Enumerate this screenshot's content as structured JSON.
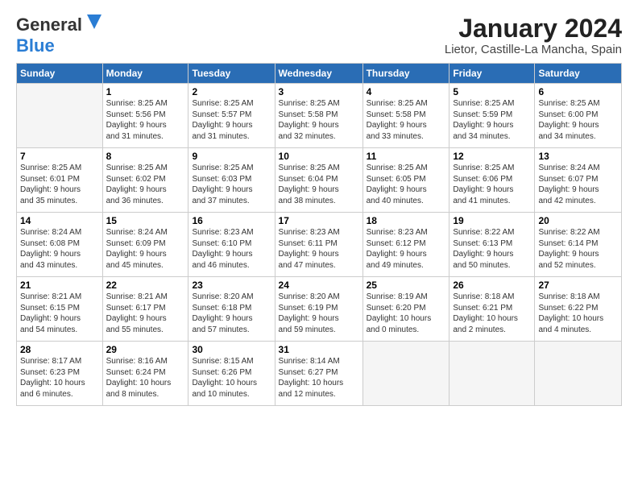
{
  "header": {
    "logo_general": "General",
    "logo_blue": "Blue",
    "month_title": "January 2024",
    "location": "Lietor, Castille-La Mancha, Spain"
  },
  "days_of_week": [
    "Sunday",
    "Monday",
    "Tuesday",
    "Wednesday",
    "Thursday",
    "Friday",
    "Saturday"
  ],
  "weeks": [
    [
      {
        "day": "",
        "info": ""
      },
      {
        "day": "1",
        "info": "Sunrise: 8:25 AM\nSunset: 5:56 PM\nDaylight: 9 hours\nand 31 minutes."
      },
      {
        "day": "2",
        "info": "Sunrise: 8:25 AM\nSunset: 5:57 PM\nDaylight: 9 hours\nand 31 minutes."
      },
      {
        "day": "3",
        "info": "Sunrise: 8:25 AM\nSunset: 5:58 PM\nDaylight: 9 hours\nand 32 minutes."
      },
      {
        "day": "4",
        "info": "Sunrise: 8:25 AM\nSunset: 5:58 PM\nDaylight: 9 hours\nand 33 minutes."
      },
      {
        "day": "5",
        "info": "Sunrise: 8:25 AM\nSunset: 5:59 PM\nDaylight: 9 hours\nand 34 minutes."
      },
      {
        "day": "6",
        "info": "Sunrise: 8:25 AM\nSunset: 6:00 PM\nDaylight: 9 hours\nand 34 minutes."
      }
    ],
    [
      {
        "day": "7",
        "info": "Sunrise: 8:25 AM\nSunset: 6:01 PM\nDaylight: 9 hours\nand 35 minutes."
      },
      {
        "day": "8",
        "info": "Sunrise: 8:25 AM\nSunset: 6:02 PM\nDaylight: 9 hours\nand 36 minutes."
      },
      {
        "day": "9",
        "info": "Sunrise: 8:25 AM\nSunset: 6:03 PM\nDaylight: 9 hours\nand 37 minutes."
      },
      {
        "day": "10",
        "info": "Sunrise: 8:25 AM\nSunset: 6:04 PM\nDaylight: 9 hours\nand 38 minutes."
      },
      {
        "day": "11",
        "info": "Sunrise: 8:25 AM\nSunset: 6:05 PM\nDaylight: 9 hours\nand 40 minutes."
      },
      {
        "day": "12",
        "info": "Sunrise: 8:25 AM\nSunset: 6:06 PM\nDaylight: 9 hours\nand 41 minutes."
      },
      {
        "day": "13",
        "info": "Sunrise: 8:24 AM\nSunset: 6:07 PM\nDaylight: 9 hours\nand 42 minutes."
      }
    ],
    [
      {
        "day": "14",
        "info": "Sunrise: 8:24 AM\nSunset: 6:08 PM\nDaylight: 9 hours\nand 43 minutes."
      },
      {
        "day": "15",
        "info": "Sunrise: 8:24 AM\nSunset: 6:09 PM\nDaylight: 9 hours\nand 45 minutes."
      },
      {
        "day": "16",
        "info": "Sunrise: 8:23 AM\nSunset: 6:10 PM\nDaylight: 9 hours\nand 46 minutes."
      },
      {
        "day": "17",
        "info": "Sunrise: 8:23 AM\nSunset: 6:11 PM\nDaylight: 9 hours\nand 47 minutes."
      },
      {
        "day": "18",
        "info": "Sunrise: 8:23 AM\nSunset: 6:12 PM\nDaylight: 9 hours\nand 49 minutes."
      },
      {
        "day": "19",
        "info": "Sunrise: 8:22 AM\nSunset: 6:13 PM\nDaylight: 9 hours\nand 50 minutes."
      },
      {
        "day": "20",
        "info": "Sunrise: 8:22 AM\nSunset: 6:14 PM\nDaylight: 9 hours\nand 52 minutes."
      }
    ],
    [
      {
        "day": "21",
        "info": "Sunrise: 8:21 AM\nSunset: 6:15 PM\nDaylight: 9 hours\nand 54 minutes."
      },
      {
        "day": "22",
        "info": "Sunrise: 8:21 AM\nSunset: 6:17 PM\nDaylight: 9 hours\nand 55 minutes."
      },
      {
        "day": "23",
        "info": "Sunrise: 8:20 AM\nSunset: 6:18 PM\nDaylight: 9 hours\nand 57 minutes."
      },
      {
        "day": "24",
        "info": "Sunrise: 8:20 AM\nSunset: 6:19 PM\nDaylight: 9 hours\nand 59 minutes."
      },
      {
        "day": "25",
        "info": "Sunrise: 8:19 AM\nSunset: 6:20 PM\nDaylight: 10 hours\nand 0 minutes."
      },
      {
        "day": "26",
        "info": "Sunrise: 8:18 AM\nSunset: 6:21 PM\nDaylight: 10 hours\nand 2 minutes."
      },
      {
        "day": "27",
        "info": "Sunrise: 8:18 AM\nSunset: 6:22 PM\nDaylight: 10 hours\nand 4 minutes."
      }
    ],
    [
      {
        "day": "28",
        "info": "Sunrise: 8:17 AM\nSunset: 6:23 PM\nDaylight: 10 hours\nand 6 minutes."
      },
      {
        "day": "29",
        "info": "Sunrise: 8:16 AM\nSunset: 6:24 PM\nDaylight: 10 hours\nand 8 minutes."
      },
      {
        "day": "30",
        "info": "Sunrise: 8:15 AM\nSunset: 6:26 PM\nDaylight: 10 hours\nand 10 minutes."
      },
      {
        "day": "31",
        "info": "Sunrise: 8:14 AM\nSunset: 6:27 PM\nDaylight: 10 hours\nand 12 minutes."
      },
      {
        "day": "",
        "info": ""
      },
      {
        "day": "",
        "info": ""
      },
      {
        "day": "",
        "info": ""
      }
    ]
  ]
}
